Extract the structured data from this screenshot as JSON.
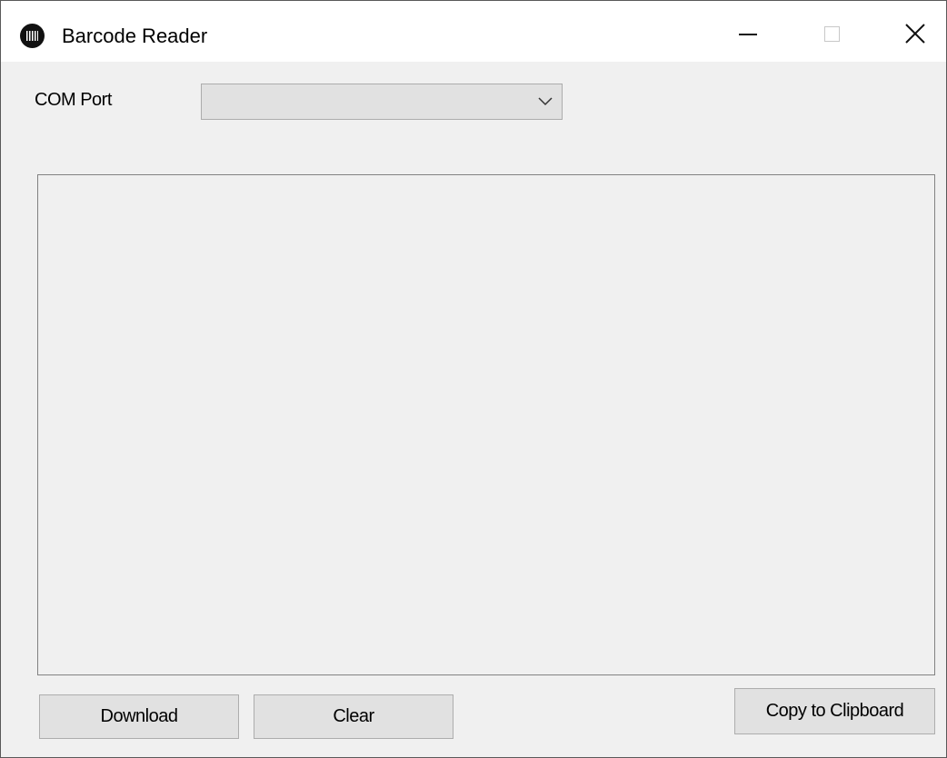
{
  "window": {
    "title": "Barcode Reader",
    "app_icon": "barcode-icon",
    "controls": {
      "minimize_icon": "minimize-icon",
      "maximize_icon": "maximize-icon",
      "close_icon": "close-icon"
    }
  },
  "form": {
    "com_port_label": "COM Port",
    "com_port_value": "",
    "output_text": "",
    "buttons": {
      "download": "Download",
      "clear": "Clear",
      "copy": "Copy to Clipboard"
    }
  },
  "colors": {
    "window_background": "#f0f0f0",
    "titlebar_background": "#ffffff",
    "button_background": "#e1e1e1"
  }
}
